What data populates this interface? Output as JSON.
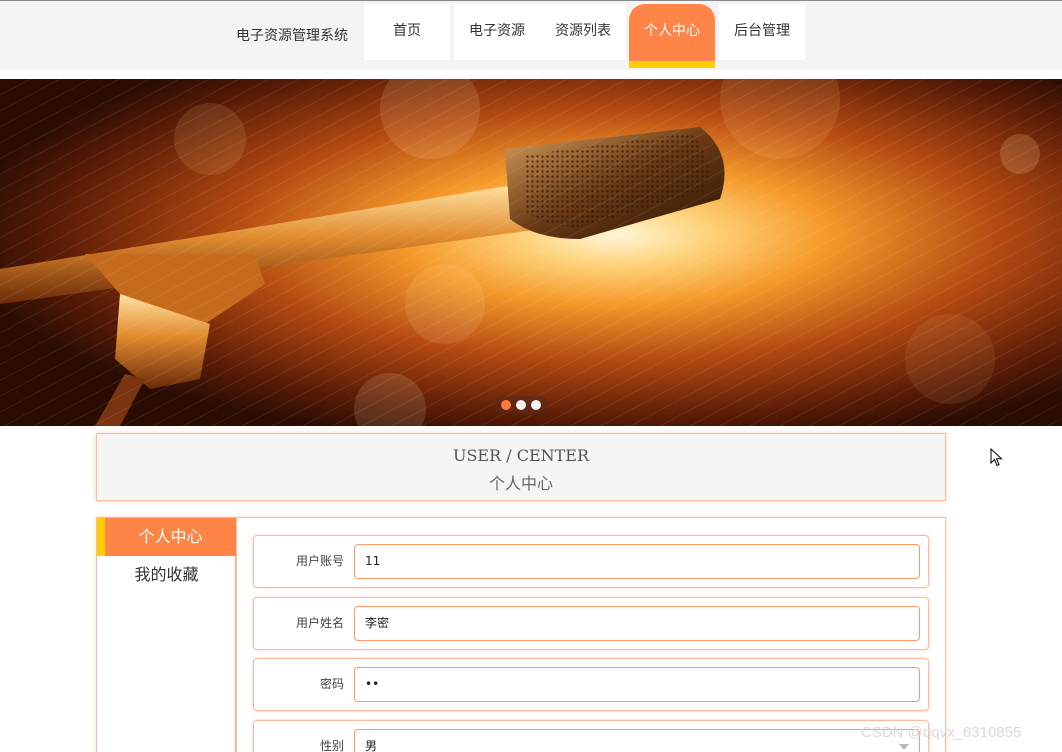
{
  "app": {
    "title": "电子资源管理系统"
  },
  "nav": {
    "items": [
      {
        "label": "首页"
      },
      {
        "label": "电子资源"
      },
      {
        "label": "资源列表"
      },
      {
        "label": "个人中心",
        "active": true
      },
      {
        "label": "后台管理"
      }
    ]
  },
  "banner": {
    "image": "microphone-illustration",
    "slides": 3,
    "active_slide": 1
  },
  "section": {
    "title_en": "USER / CENTER",
    "title_cn": "个人中心"
  },
  "sidebar": {
    "items": [
      {
        "label": "个人中心",
        "active": true
      },
      {
        "label": "我的收藏"
      }
    ]
  },
  "form": {
    "fields": [
      {
        "label": "用户账号",
        "value": "11"
      },
      {
        "label": "用户姓名",
        "value": "李密"
      },
      {
        "label": "密码",
        "value": "••"
      },
      {
        "label": "性别",
        "value": "男"
      }
    ]
  },
  "watermark": "CSDN @qqvx_6310855",
  "colors": {
    "accent": "#ff8447",
    "accent_bar": "#ffce00",
    "border": "#ffbba0"
  },
  "icons": {
    "cursor": "mouse-pointer-icon",
    "select": "chevron-down-icon"
  }
}
